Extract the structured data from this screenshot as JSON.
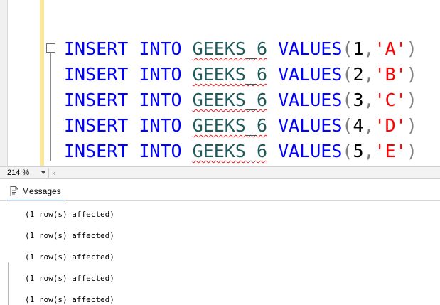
{
  "editor": {
    "lines": [
      {
        "keyword1": "INSERT",
        "keyword2": "INTO",
        "table": "GEEKS_6",
        "keyword3": "VALUES",
        "open": "(",
        "num": "1",
        "comma": ",",
        "str": "'A'",
        "close": ")"
      },
      {
        "keyword1": "INSERT",
        "keyword2": "INTO",
        "table": "GEEKS_6",
        "keyword3": "VALUES",
        "open": "(",
        "num": "2",
        "comma": ",",
        "str": "'B'",
        "close": ")"
      },
      {
        "keyword1": "INSERT",
        "keyword2": "INTO",
        "table": "GEEKS_6",
        "keyword3": "VALUES",
        "open": "(",
        "num": "3",
        "comma": ",",
        "str": "'C'",
        "close": ")"
      },
      {
        "keyword1": "INSERT",
        "keyword2": "INTO",
        "table": "GEEKS_6",
        "keyword3": "VALUES",
        "open": "(",
        "num": "4",
        "comma": ",",
        "str": "'D'",
        "close": ")"
      },
      {
        "keyword1": "INSERT",
        "keyword2": "INTO",
        "table": "GEEKS_6",
        "keyword3": "VALUES",
        "open": "(",
        "num": "5",
        "comma": ",",
        "str": "'E'",
        "close": ")"
      }
    ],
    "colors": {
      "keyword": "#0000ff",
      "identifier": "#215a5a",
      "string": "#ff0000",
      "squiggle": "#e02020"
    }
  },
  "status_bar": {
    "zoom": "214 %",
    "zoom_icon": "chevron-down-icon",
    "scroll_icon": "chevron-left-icon",
    "scroll_glyph": "‹"
  },
  "results": {
    "tab_label": "Messages",
    "tab_icon": "messages-icon",
    "messages": [
      "(1 row(s) affected)",
      "(1 row(s) affected)",
      "(1 row(s) affected)",
      "(1 row(s) affected)",
      "(1 row(s) affected)"
    ]
  }
}
